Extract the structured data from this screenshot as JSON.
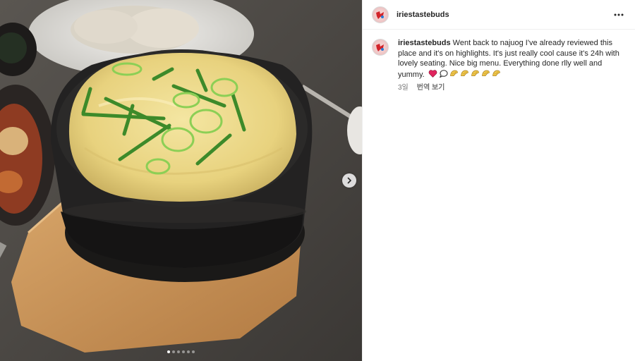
{
  "post": {
    "username": "iriestastebuds",
    "caption": "Went back to najuog I've already reviewed this place and it's on highlights. It's just really cool cause it's 24h with lovely seating. Nice big menu. Everything done rlly well and yummy.",
    "time_ago": "3일",
    "translate_label": "번역 보기",
    "emojis": [
      "heart-icon",
      "speech-bubble-icon",
      "dumpling-icon",
      "dumpling-icon",
      "dumpling-icon",
      "dumpling-icon",
      "dumpling-icon"
    ]
  },
  "carousel": {
    "slide_count": 6,
    "active_index": 0
  },
  "colors": {
    "text": "#262626",
    "secondary": "#737373",
    "divider": "#efefef",
    "heart": "#e0245e",
    "dumpling": "#f2c94c"
  }
}
